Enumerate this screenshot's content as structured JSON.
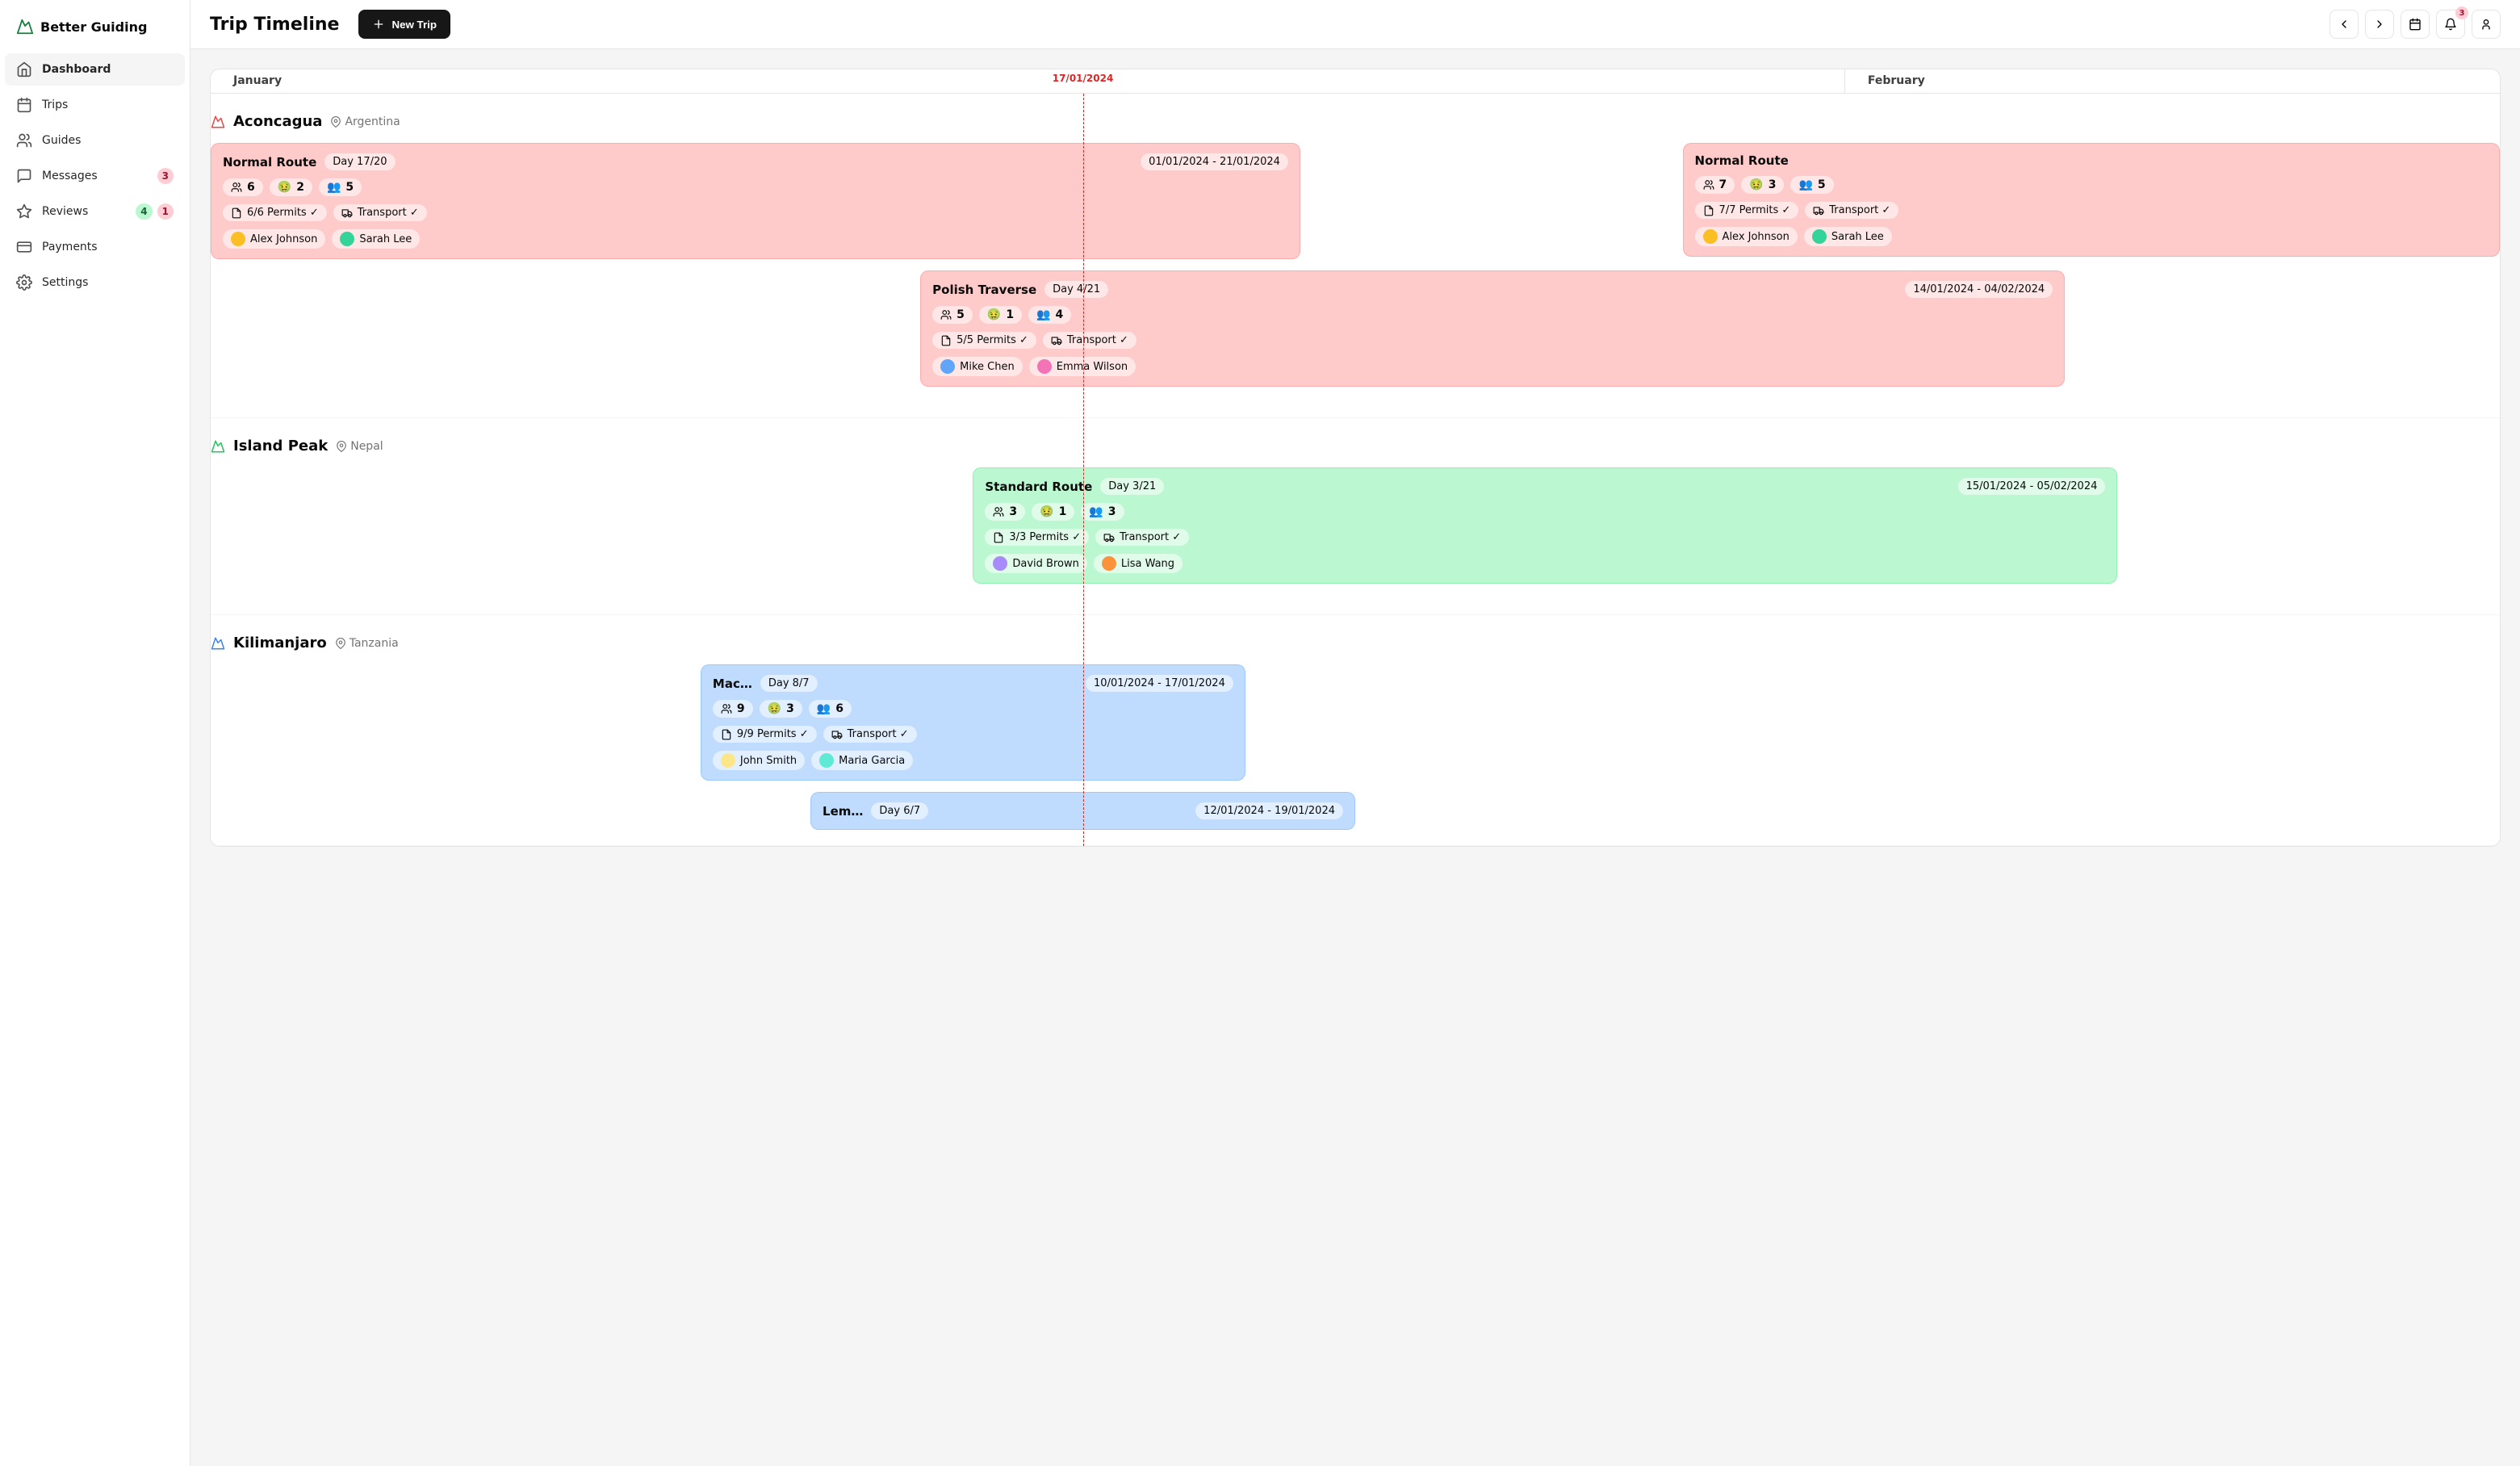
{
  "brand": "Better Guiding",
  "nav": {
    "dashboard": "Dashboard",
    "trips": "Trips",
    "guides": "Guides",
    "messages": "Messages",
    "messages_badge": "3",
    "reviews": "Reviews",
    "reviews_badge_a": "4",
    "reviews_badge_b": "1",
    "payments": "Payments",
    "settings": "Settings"
  },
  "header": {
    "title": "Trip Timeline",
    "new_trip": "New Trip",
    "notifications": "3"
  },
  "timeline": {
    "today": "17/01/2024",
    "months": {
      "jan": "January",
      "feb": "February"
    }
  },
  "peaks": [
    {
      "name": "Aconcagua",
      "country": "Argentina",
      "color": "#ef4444",
      "trips": [
        {
          "name": "Normal Route",
          "day_label": "Day 17/20",
          "dates": "01/01/2024 - 21/01/2024",
          "left": "0%",
          "width": "47.6%",
          "counts": {
            "people": "6",
            "sick": "2",
            "pair": "5"
          },
          "permits": "6/6 Permits ✓",
          "transport": "Transport ✓",
          "guides": [
            {
              "name": "Alex Johnson",
              "color": "#fbbf24"
            },
            {
              "name": "Sarah Lee",
              "color": "#34d399"
            }
          ],
          "tone": "red"
        },
        {
          "name": "Normal Route",
          "day_label": "",
          "dates": "",
          "left": "64.3%",
          "width": "35.7%",
          "counts": {
            "people": "7",
            "sick": "3",
            "pair": "5"
          },
          "permits": "7/7 Permits ✓",
          "transport": "Transport ✓",
          "guides": [
            {
              "name": "Alex Johnson",
              "color": "#fbbf24"
            },
            {
              "name": "Sarah Lee",
              "color": "#34d399"
            }
          ],
          "tone": "red"
        },
        {
          "name": "Polish Traverse",
          "day_label": "Day 4/21",
          "dates": "14/01/2024 - 04/02/2024",
          "left": "31%",
          "width": "50%",
          "counts": {
            "people": "5",
            "sick": "1",
            "pair": "4"
          },
          "permits": "5/5 Permits ✓",
          "transport": "Transport ✓",
          "guides": [
            {
              "name": "Mike Chen",
              "color": "#60a5fa"
            },
            {
              "name": "Emma Wilson",
              "color": "#f472b6"
            }
          ],
          "tone": "red"
        }
      ]
    },
    {
      "name": "Island Peak",
      "country": "Nepal",
      "color": "#22c55e",
      "trips": [
        {
          "name": "Standard Route",
          "day_label": "Day 3/21",
          "dates": "15/01/2024 - 05/02/2024",
          "left": "33.3%",
          "width": "50%",
          "counts": {
            "people": "3",
            "sick": "1",
            "pair": "3"
          },
          "permits": "3/3 Permits ✓",
          "transport": "Transport ✓",
          "guides": [
            {
              "name": "David Brown",
              "color": "#a78bfa"
            },
            {
              "name": "Lisa Wang",
              "color": "#fb923c"
            }
          ],
          "tone": "green"
        }
      ]
    },
    {
      "name": "Kilimanjaro",
      "country": "Tanzania",
      "color": "#3b82f6",
      "trips": [
        {
          "name": "Mac…",
          "day_label": "Day 8/7",
          "dates": "10/01/2024 - 17/01/2024",
          "left": "21.4%",
          "width": "23.8%",
          "counts": {
            "people": "9",
            "sick": "3",
            "pair": "6"
          },
          "permits": "9/9 Permits ✓",
          "transport": "Transport ✓",
          "guides": [
            {
              "name": "John Smith",
              "color": "#fde68a"
            },
            {
              "name": "Maria Garcia",
              "color": "#5eead4"
            }
          ],
          "tone": "blue"
        },
        {
          "name": "Lem…",
          "day_label": "Day 6/7",
          "dates": "12/01/2024 - 19/01/2024",
          "left": "26.2%",
          "width": "23.8%",
          "counts": {
            "people": "",
            "sick": "",
            "pair": ""
          },
          "permits": "",
          "transport": "",
          "guides": [],
          "tone": "blue"
        }
      ]
    }
  ]
}
